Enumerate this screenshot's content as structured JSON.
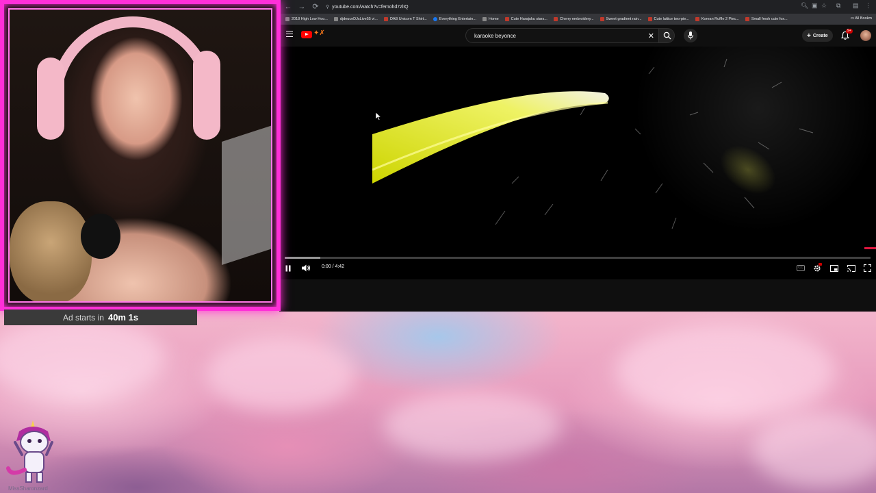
{
  "browser": {
    "url": "youtube.com/watch?v=femohd7zlIQ",
    "bookmarks": [
      "2018 High Low Hoo...",
      "djdeuceDJsLive55 vi...",
      "DAB Unicorn T Shirt...",
      "Everything Entertain...",
      "Home",
      "Cute Harajuku stars...",
      "Cherry embroidery...",
      "Sweet gradient rain...",
      "Cute lattice two-pie...",
      "Korean Ruffle 2 Piec...",
      "Small fresh cute fox..."
    ],
    "all_bookmarks": "All Bookm"
  },
  "youtube": {
    "search_value": "karaoke beyonce",
    "create_label": "Create",
    "notif_badge": "9+",
    "time": "0:00 / 4:42",
    "progress": 0.0
  },
  "overlay": {
    "ad_label": "Ad starts in",
    "ad_time": "40m 1s",
    "username": "MissSharonzard"
  },
  "colors": {
    "frame": "#ff2fd8",
    "yt_red": "#ff0000"
  }
}
